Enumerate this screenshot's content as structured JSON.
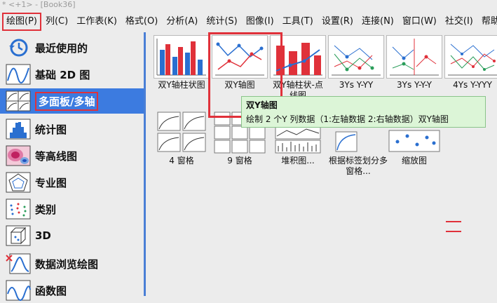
{
  "window": {
    "title": "* <+1> - [Book36]"
  },
  "menu": [
    "绘图(P)",
    "列(C)",
    "工作表(K)",
    "格式(O)",
    "分析(A)",
    "统计(S)",
    "图像(I)",
    "工具(T)",
    "设置(R)",
    "连接(N)",
    "窗口(W)",
    "社交(I)",
    "帮助"
  ],
  "categories": [
    {
      "label": "最近使用的",
      "icon": "recent-clock-icon"
    },
    {
      "label": "基础 2D 图",
      "icon": "line-curve-icon"
    },
    {
      "label": "多面板/多轴",
      "icon": "multi-panel-icon"
    },
    {
      "label": "统计图",
      "icon": "histogram-icon"
    },
    {
      "label": "等高线图",
      "icon": "contour-icon"
    },
    {
      "label": "专业图",
      "icon": "polar-icon"
    },
    {
      "label": "类别",
      "icon": "scatter-icon"
    },
    {
      "label": "3D",
      "icon": "cube-icon"
    },
    {
      "label": "数据浏览绘图",
      "icon": "data-explore-icon"
    },
    {
      "label": "函数图",
      "icon": "function-icon"
    }
  ],
  "templates_row1": [
    {
      "label": "双Y轴柱状图",
      "icon": "double-y-column-icon"
    },
    {
      "label": "双Y轴图",
      "icon": "double-y-icon"
    },
    {
      "label": "双Y轴柱状-点线图",
      "icon": "double-y-column-line-icon"
    },
    {
      "label": "3Ys Y-YY",
      "icon": "three-y-yyy-icon"
    },
    {
      "label": "3Ys Y-Y-Y",
      "icon": "three-y-y-y-icon"
    },
    {
      "label": "4Ys Y-YYY",
      "icon": "four-y-yyy-icon"
    }
  ],
  "templates_row2": [
    {
      "label": "4 窗格",
      "icon": "four-panel-icon"
    },
    {
      "label": "9 窗格",
      "icon": "nine-panel-icon"
    },
    {
      "label": "堆积图...",
      "icon": "stack-icon"
    },
    {
      "label": "根据标签划分多窗格...",
      "icon": "label-split-icon"
    },
    {
      "label": "缩放图",
      "icon": "zoom-icon"
    }
  ],
  "tooltip": {
    "title": "双Y轴图",
    "desc": "绘制 2 个Y 列数据（1:左轴数据 2:右轴数据）双Y轴图"
  },
  "colors": {
    "accent": "#3c7be0",
    "highlight": "#e0313a",
    "tooltip_bg": "#dcf5d7"
  }
}
